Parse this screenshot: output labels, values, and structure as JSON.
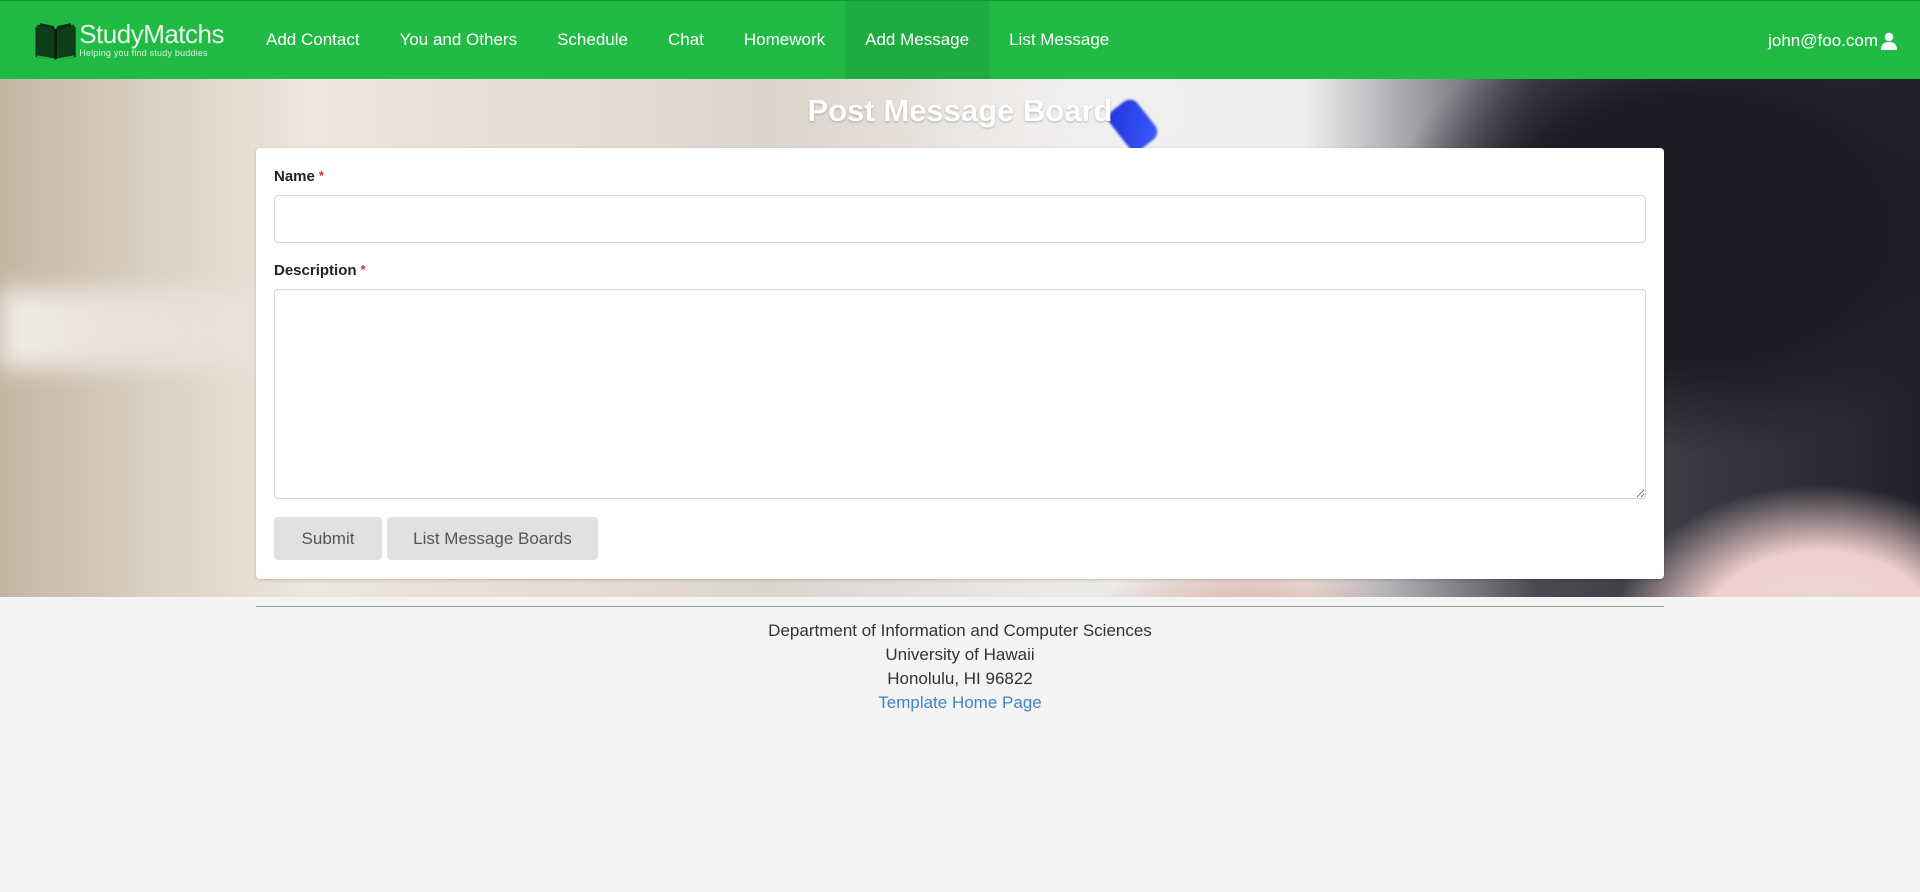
{
  "brand": {
    "name": "StudyMatchs",
    "tagline": "Helping you find study buddies"
  },
  "nav": {
    "items": [
      {
        "label": "Add Contact"
      },
      {
        "label": "You and Others"
      },
      {
        "label": "Schedule"
      },
      {
        "label": "Chat"
      },
      {
        "label": "Homework"
      },
      {
        "label": "Add Message",
        "active": true
      },
      {
        "label": "List Message"
      }
    ],
    "user": "john@foo.com"
  },
  "page": {
    "title": "Post Message Board"
  },
  "form": {
    "name_label": "Name",
    "name_value": "",
    "description_label": "Description",
    "description_value": "",
    "required_mark": "*",
    "submit_label": "Submit",
    "list_label": "List Message Boards"
  },
  "footer": {
    "line1": "Department of Information and Computer Sciences",
    "line2": "University of Hawaii",
    "line3": "Honolulu, HI 96822",
    "link": "Template Home Page"
  },
  "colors": {
    "navbar": "#21ba45",
    "required": "#db2828",
    "link": "#4183c4",
    "button": "#e0e1e2"
  },
  "icons": {
    "logo": "open-book-icon",
    "user": "user-icon"
  }
}
